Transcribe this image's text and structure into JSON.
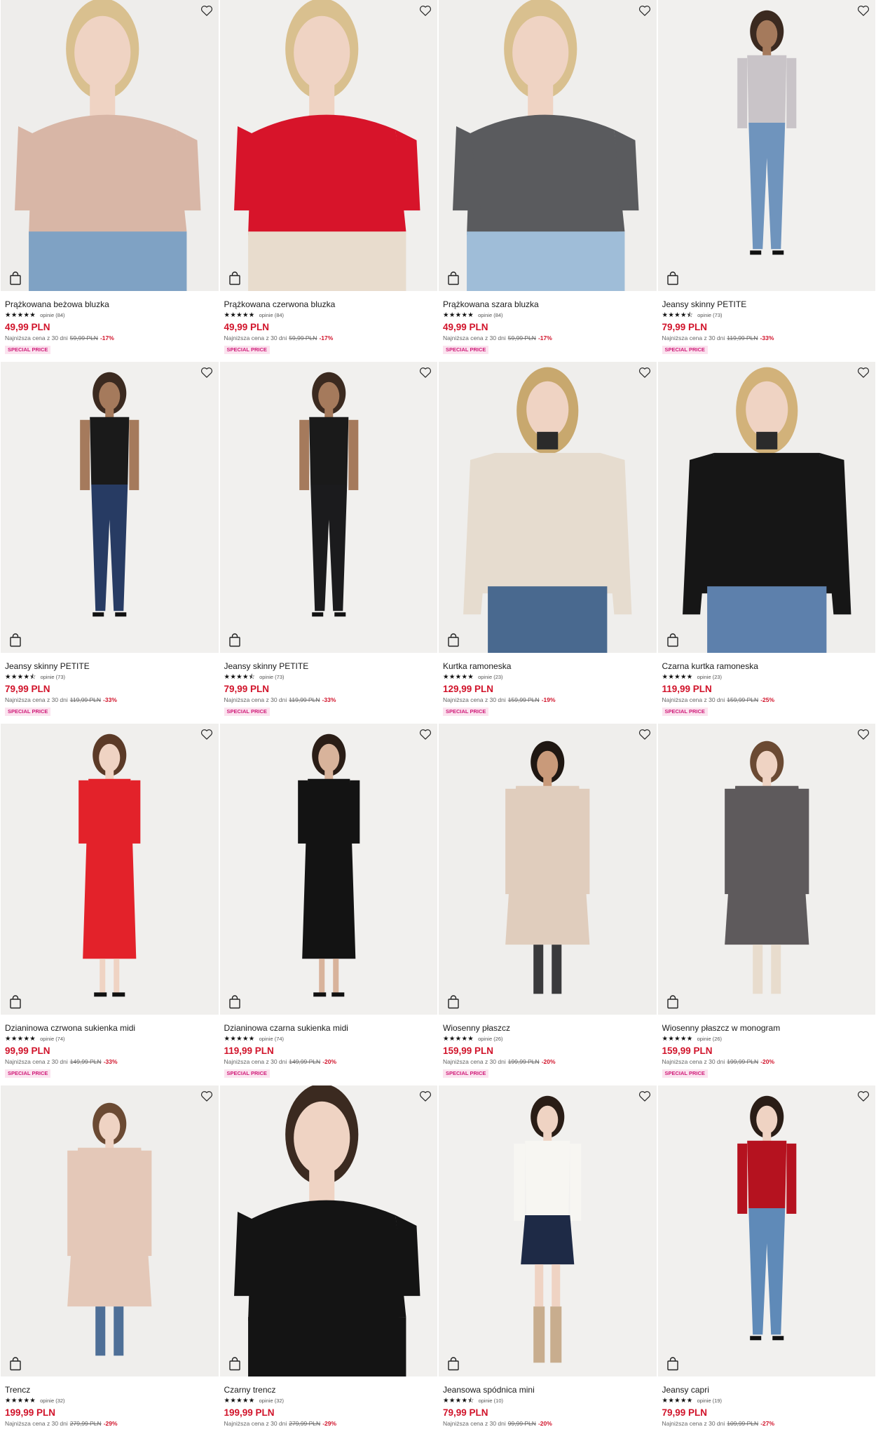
{
  "ui": {
    "wishlist_icon": "heart-outline-icon",
    "add_to_cart_icon": "shopping-bag-icon",
    "accent_color": "#d1132a",
    "badge_text_color": "#d01c79",
    "badge_bg_color": "#fbe3ef"
  },
  "products": [
    {
      "name": "Prążkowana beżowa bluzka",
      "stars": 5,
      "stars_text": "★★★★★",
      "reviews": "opinie (84)",
      "price": "49,99 PLN",
      "lowest_label": "Najniższa cena z 30 dni",
      "lowest_old": "59,99 PLN",
      "discount": "-17%",
      "badge": "SPECIAL PRICE",
      "photo": {
        "bg": "#eeedeb",
        "top": "#d8b6a6",
        "bottom": "#7fa2c4",
        "skin": "#efd3c3",
        "hair": "#d9c08f",
        "style": "closeup"
      }
    },
    {
      "name": "Prążkowana czerwona bluzka",
      "stars": 5,
      "stars_text": "★★★★★",
      "reviews": "opinie (84)",
      "price": "49,99 PLN",
      "lowest_label": "Najniższa cena z 30 dni",
      "lowest_old": "59,99 PLN",
      "discount": "-17%",
      "badge": "SPECIAL PRICE",
      "photo": {
        "bg": "#f0efed",
        "top": "#d7142a",
        "bottom": "#e8dccd",
        "skin": "#efd3c3",
        "hair": "#d9c08f",
        "style": "closeup"
      }
    },
    {
      "name": "Prążkowana szara bluzka",
      "stars": 5,
      "stars_text": "★★★★★",
      "reviews": "opinie (84)",
      "price": "49,99 PLN",
      "lowest_label": "Najniższa cena z 30 dni",
      "lowest_old": "59,99 PLN",
      "discount": "-17%",
      "badge": "SPECIAL PRICE",
      "photo": {
        "bg": "#efeeec",
        "top": "#5a5b5e",
        "bottom": "#9fbdd8",
        "skin": "#efd3c3",
        "hair": "#d9c08f",
        "style": "closeup"
      }
    },
    {
      "name": "Jeansy skinny PETITE",
      "stars": 4.5,
      "stars_text": "★★★★⯪",
      "reviews": "opinie (73)",
      "price": "79,99 PLN",
      "lowest_label": "Najniższa cena z 30 dni",
      "lowest_old": "119,99 PLN",
      "discount": "-33%",
      "badge": "SPECIAL PRICE",
      "photo": {
        "bg": "#f1f0ee",
        "top": "#c9c4c8",
        "bottom": "#6f94bd",
        "skin": "#a57a5c",
        "hair": "#3b2a20",
        "style": "full"
      }
    },
    {
      "name": "Jeansy skinny PETITE",
      "stars": 4.5,
      "stars_text": "★★★★⯪",
      "reviews": "opinie (73)",
      "price": "79,99 PLN",
      "lowest_label": "Najniższa cena z 30 dni",
      "lowest_old": "119,99 PLN",
      "discount": "-33%",
      "badge": "SPECIAL PRICE",
      "photo": {
        "bg": "#f1f0ee",
        "top": "#1a1a1a",
        "bottom": "#273b63",
        "skin": "#a57a5c",
        "hair": "#3b2a20",
        "style": "full"
      }
    },
    {
      "name": "Jeansy skinny PETITE",
      "stars": 4.5,
      "stars_text": "★★★★⯪",
      "reviews": "opinie (73)",
      "price": "79,99 PLN",
      "lowest_label": "Najniższa cena z 30 dni",
      "lowest_old": "119,99 PLN",
      "discount": "-33%",
      "badge": "SPECIAL PRICE",
      "photo": {
        "bg": "#f1f0ee",
        "top": "#1a1a1a",
        "bottom": "#1b1b1d",
        "skin": "#a57a5c",
        "hair": "#3b2a20",
        "style": "full"
      }
    },
    {
      "name": "Kurtka ramoneska",
      "stars": 5,
      "stars_text": "★★★★★",
      "reviews": "opinie (23)",
      "price": "129,99 PLN",
      "lowest_label": "Najniższa cena z 30 dni",
      "lowest_old": "159,99 PLN",
      "discount": "-19%",
      "badge": "SPECIAL PRICE",
      "photo": {
        "bg": "#efeeec",
        "top": "#e6dccf",
        "bottom": "#49698f",
        "skin": "#efd3c3",
        "hair": "#c8a86e",
        "style": "jacket"
      }
    },
    {
      "name": "Czarna kurtka ramoneska",
      "stars": 5,
      "stars_text": "★★★★★",
      "reviews": "opinie (23)",
      "price": "119,99 PLN",
      "lowest_label": "Najniższa cena z 30 dni",
      "lowest_old": "159,99 PLN",
      "discount": "-25%",
      "badge": "SPECIAL PRICE",
      "photo": {
        "bg": "#efeeec",
        "top": "#161616",
        "bottom": "#5d80ac",
        "skin": "#efd3c3",
        "hair": "#d2b27a",
        "style": "jacket"
      }
    },
    {
      "name": "Dzianinowa czrwona sukienka midi",
      "stars": 5,
      "stars_text": "★★★★★",
      "reviews": "opinie (74)",
      "price": "99,99 PLN",
      "lowest_label": "Najniższa cena z 30 dni",
      "lowest_old": "149,99 PLN",
      "discount": "-33%",
      "badge": "SPECIAL PRICE",
      "photo": {
        "bg": "#f0efed",
        "top": "#e3222a",
        "bottom": "#e3222a",
        "skin": "#efd3c3",
        "hair": "#5b3a27",
        "style": "dress"
      }
    },
    {
      "name": "Dzianinowa czarna sukienka midi",
      "stars": 5,
      "stars_text": "★★★★★",
      "reviews": "opinie (74)",
      "price": "119,99 PLN",
      "lowest_label": "Najniższa cena z 30 dni",
      "lowest_old": "149,99 PLN",
      "discount": "-20%",
      "badge": "SPECIAL PRICE",
      "photo": {
        "bg": "#f1f0ee",
        "top": "#131313",
        "bottom": "#131313",
        "skin": "#d8b39b",
        "hair": "#2a1d16",
        "style": "dress"
      }
    },
    {
      "name": "Wiosenny płaszcz",
      "stars": 5,
      "stars_text": "★★★★★",
      "reviews": "opinie (26)",
      "price": "159,99 PLN",
      "lowest_label": "Najniższa cena z 30 dni",
      "lowest_old": "199,99 PLN",
      "discount": "-20%",
      "badge": "SPECIAL PRICE",
      "photo": {
        "bg": "#efeeec",
        "top": "#e0cdbd",
        "bottom": "#3a3a3c",
        "skin": "#c99a7a",
        "hair": "#1f1712",
        "style": "coat"
      }
    },
    {
      "name": "Wiosenny płaszcz w monogram",
      "stars": 5,
      "stars_text": "★★★★★",
      "reviews": "opinie (26)",
      "price": "159,99 PLN",
      "lowest_label": "Najniższa cena z 30 dni",
      "lowest_old": "199,99 PLN",
      "discount": "-20%",
      "badge": "SPECIAL PRICE",
      "photo": {
        "bg": "#f0efed",
        "top": "#5e5a5c",
        "bottom": "#e8dccd",
        "skin": "#efd3c3",
        "hair": "#6b4a33",
        "style": "coat"
      }
    },
    {
      "name": "Trencz",
      "stars": 5,
      "stars_text": "★★★★★",
      "reviews": "opinie (32)",
      "price": "199,99 PLN",
      "lowest_label": "Najniższa cena z 30 dni",
      "lowest_old": "279,99 PLN",
      "discount": "-29%",
      "badge": "",
      "photo": {
        "bg": "#efeeec",
        "top": "#e4c8b8",
        "bottom": "#4e6f97",
        "skin": "#efd3c3",
        "hair": "#6b4a33",
        "style": "coat"
      }
    },
    {
      "name": "Czarny trencz",
      "stars": 5,
      "stars_text": "★★★★★",
      "reviews": "opinie (32)",
      "price": "199,99 PLN",
      "lowest_label": "Najniższa cena z 30 dni",
      "lowest_old": "279,99 PLN",
      "discount": "-29%",
      "badge": "",
      "photo": {
        "bg": "#f1f0ee",
        "top": "#141414",
        "bottom": "#141414",
        "skin": "#efd3c3",
        "hair": "#3b2a20",
        "style": "closeup"
      }
    },
    {
      "name": "Jeansowa spódnica mini",
      "stars": 4.5,
      "stars_text": "★★★★⯪",
      "reviews": "opinie (10)",
      "price": "79,99 PLN",
      "lowest_label": "Najniższa cena z 30 dni",
      "lowest_old": "99,99 PLN",
      "discount": "-20%",
      "badge": "",
      "photo": {
        "bg": "#f1f0ee",
        "top": "#f7f6f2",
        "bottom": "#1e2a46",
        "skin": "#efd3c3",
        "hair": "#2a1d16",
        "style": "skirt"
      }
    },
    {
      "name": "Jeansy capri",
      "stars": 5,
      "stars_text": "★★★★★",
      "reviews": "opinie (19)",
      "price": "79,99 PLN",
      "lowest_label": "Najniższa cena z 30 dni",
      "lowest_old": "109,99 PLN",
      "discount": "-27%",
      "badge": "",
      "photo": {
        "bg": "#f1f0ee",
        "top": "#b5121f",
        "bottom": "#5f8ab8",
        "skin": "#efd3c3",
        "hair": "#2a1d16",
        "style": "full"
      }
    }
  ]
}
